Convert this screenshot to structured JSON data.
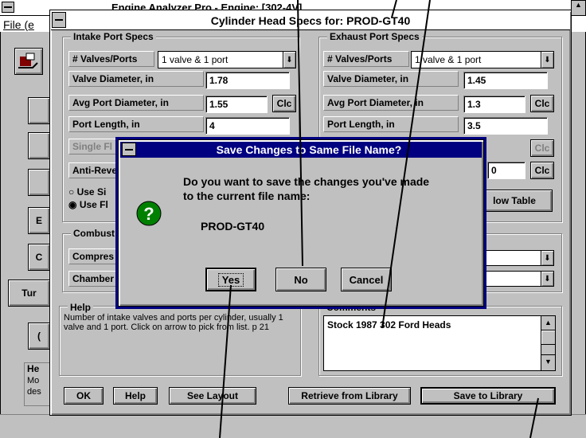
{
  "bg_window": {
    "title": "Engine Analyzer Pro - Engine: [302-4V]",
    "menu_file": "File (e",
    "help_title": "He",
    "help_text_lines": [
      "Mo",
      "des"
    ],
    "side_buttons": [
      "",
      "",
      "",
      "E",
      "C",
      "Tur",
      "("
    ]
  },
  "main": {
    "title": "Cylinder Head Specs for: PROD-GT40",
    "intake": {
      "group": "Intake Port Specs",
      "valves_label": "# Valves/Ports",
      "valves_value": "1 valve & 1 port",
      "valve_dia_label": "Valve Diameter, in",
      "valve_dia": "1.78",
      "avg_port_label": "Avg Port Diameter, in",
      "avg_port": "1.55",
      "clc": "Clc",
      "port_len_label": "Port Length, in",
      "port_len": "4",
      "single_flow_label": "Single Fl",
      "anti_rev_label": "Anti-Reve",
      "opt_single": "Use Si",
      "opt_flow": "Use Fl"
    },
    "exhaust": {
      "group": "Exhaust Port Specs",
      "valves_label": "# Valves/Ports",
      "valves_value": "1 valve & 1 port",
      "valve_dia_label": "Valve Diameter, in",
      "valve_dia": "1.45",
      "avg_port_label": "Avg Port Diameter, in",
      "avg_port": "1.3",
      "clc": "Clc",
      "port_len_label": "Port Length, in",
      "port_len": "3.5",
      "clc2": "Clc",
      "anti_value": "0",
      "clc3": "Clc",
      "flow_table": "low Table"
    },
    "combustion": {
      "group": "Combust",
      "compres_label": "Compres",
      "chamber_label": "Chamber"
    },
    "help": {
      "group": "Help",
      "text": "Number of intake valves and ports per cylinder, usually 1 valve and 1 port.  Click on arrow to pick from list.  p 21"
    },
    "comments": {
      "group": "Comments",
      "text": "Stock 1987 302 Ford Heads"
    },
    "buttons": {
      "ok": "OK",
      "help": "Help",
      "see_layout": "See Layout",
      "retrieve": "Retrieve from Library",
      "save_lib": "Save to Library"
    }
  },
  "dialog": {
    "title": "Save Changes to Same File Name?",
    "message_line1": "Do you want to save the changes you've made",
    "message_line2": "to the current file name:",
    "filename": "PROD-GT40",
    "yes": "Yes",
    "no": "No",
    "cancel": "Cancel"
  }
}
